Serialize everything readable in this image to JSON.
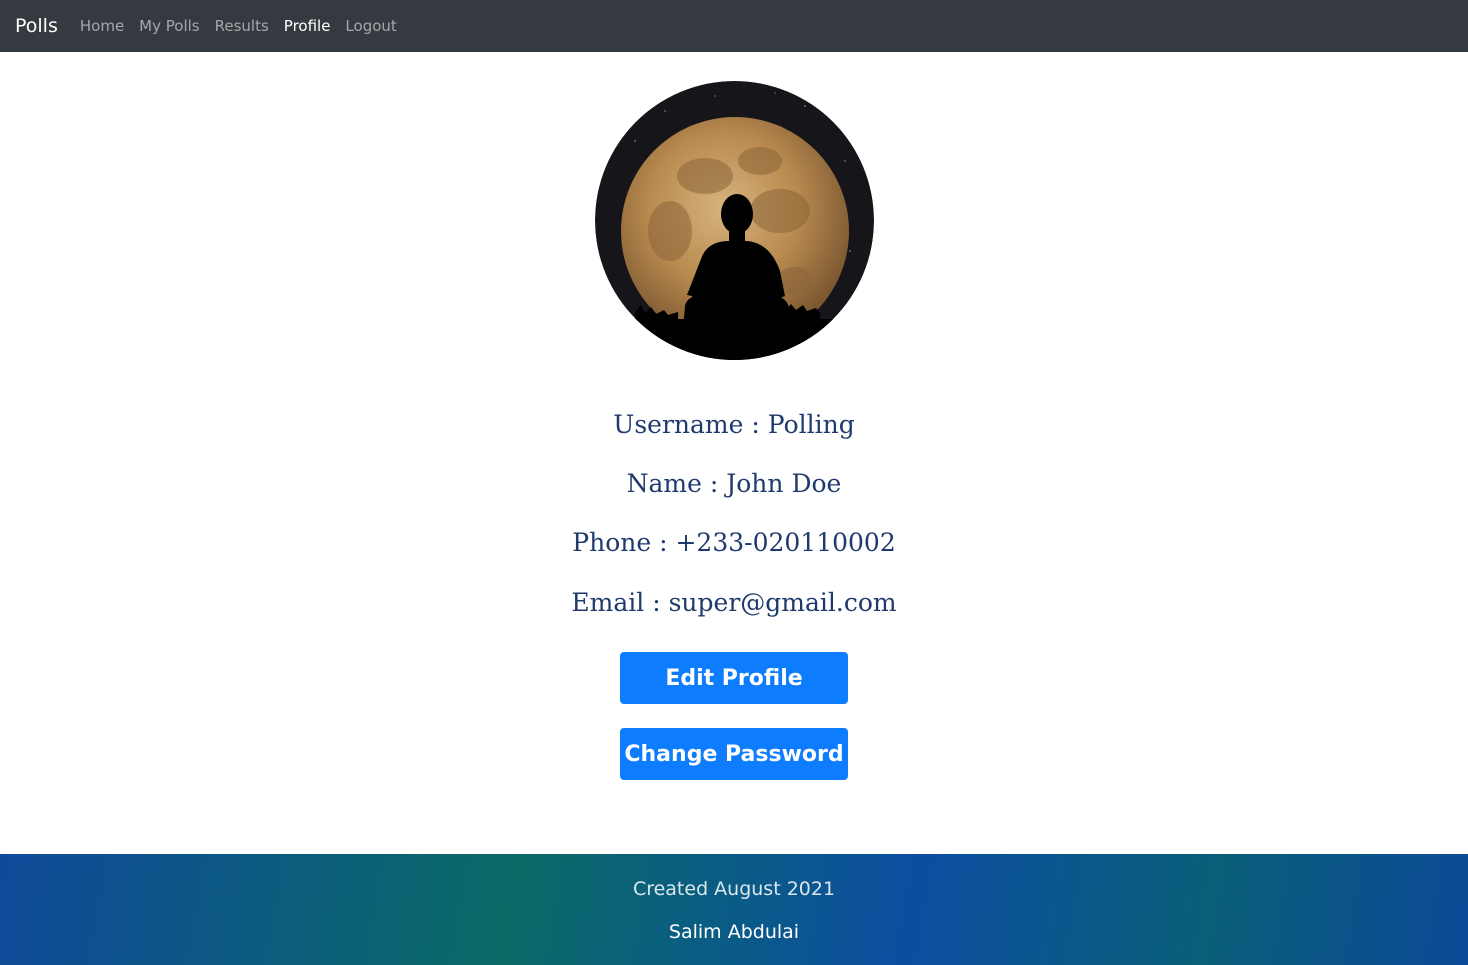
{
  "navbar": {
    "brand": "Polls",
    "links": [
      "Home",
      "My Polls",
      "Results",
      "Profile",
      "Logout"
    ],
    "active": "Profile"
  },
  "profile": {
    "username": {
      "label": "Username",
      "value": "Polling"
    },
    "name": {
      "label": "Name",
      "value": "John Doe"
    },
    "phone": {
      "label": "Phone",
      "value": "+233-020110002"
    },
    "email": {
      "label": "Email",
      "value": "super@gmail.com"
    },
    "separator": " : "
  },
  "buttons": {
    "edit_profile": "Edit Profile",
    "change_password": "Change Password"
  },
  "footer": {
    "created": "Created August 2021",
    "author": "Salim Abdulai"
  },
  "colors": {
    "navbar_bg": "#343a40",
    "button_bg": "#0d7cff",
    "info_text": "#1f3a6d"
  },
  "icons": {
    "avatar": "moon-silhouette-avatar"
  }
}
